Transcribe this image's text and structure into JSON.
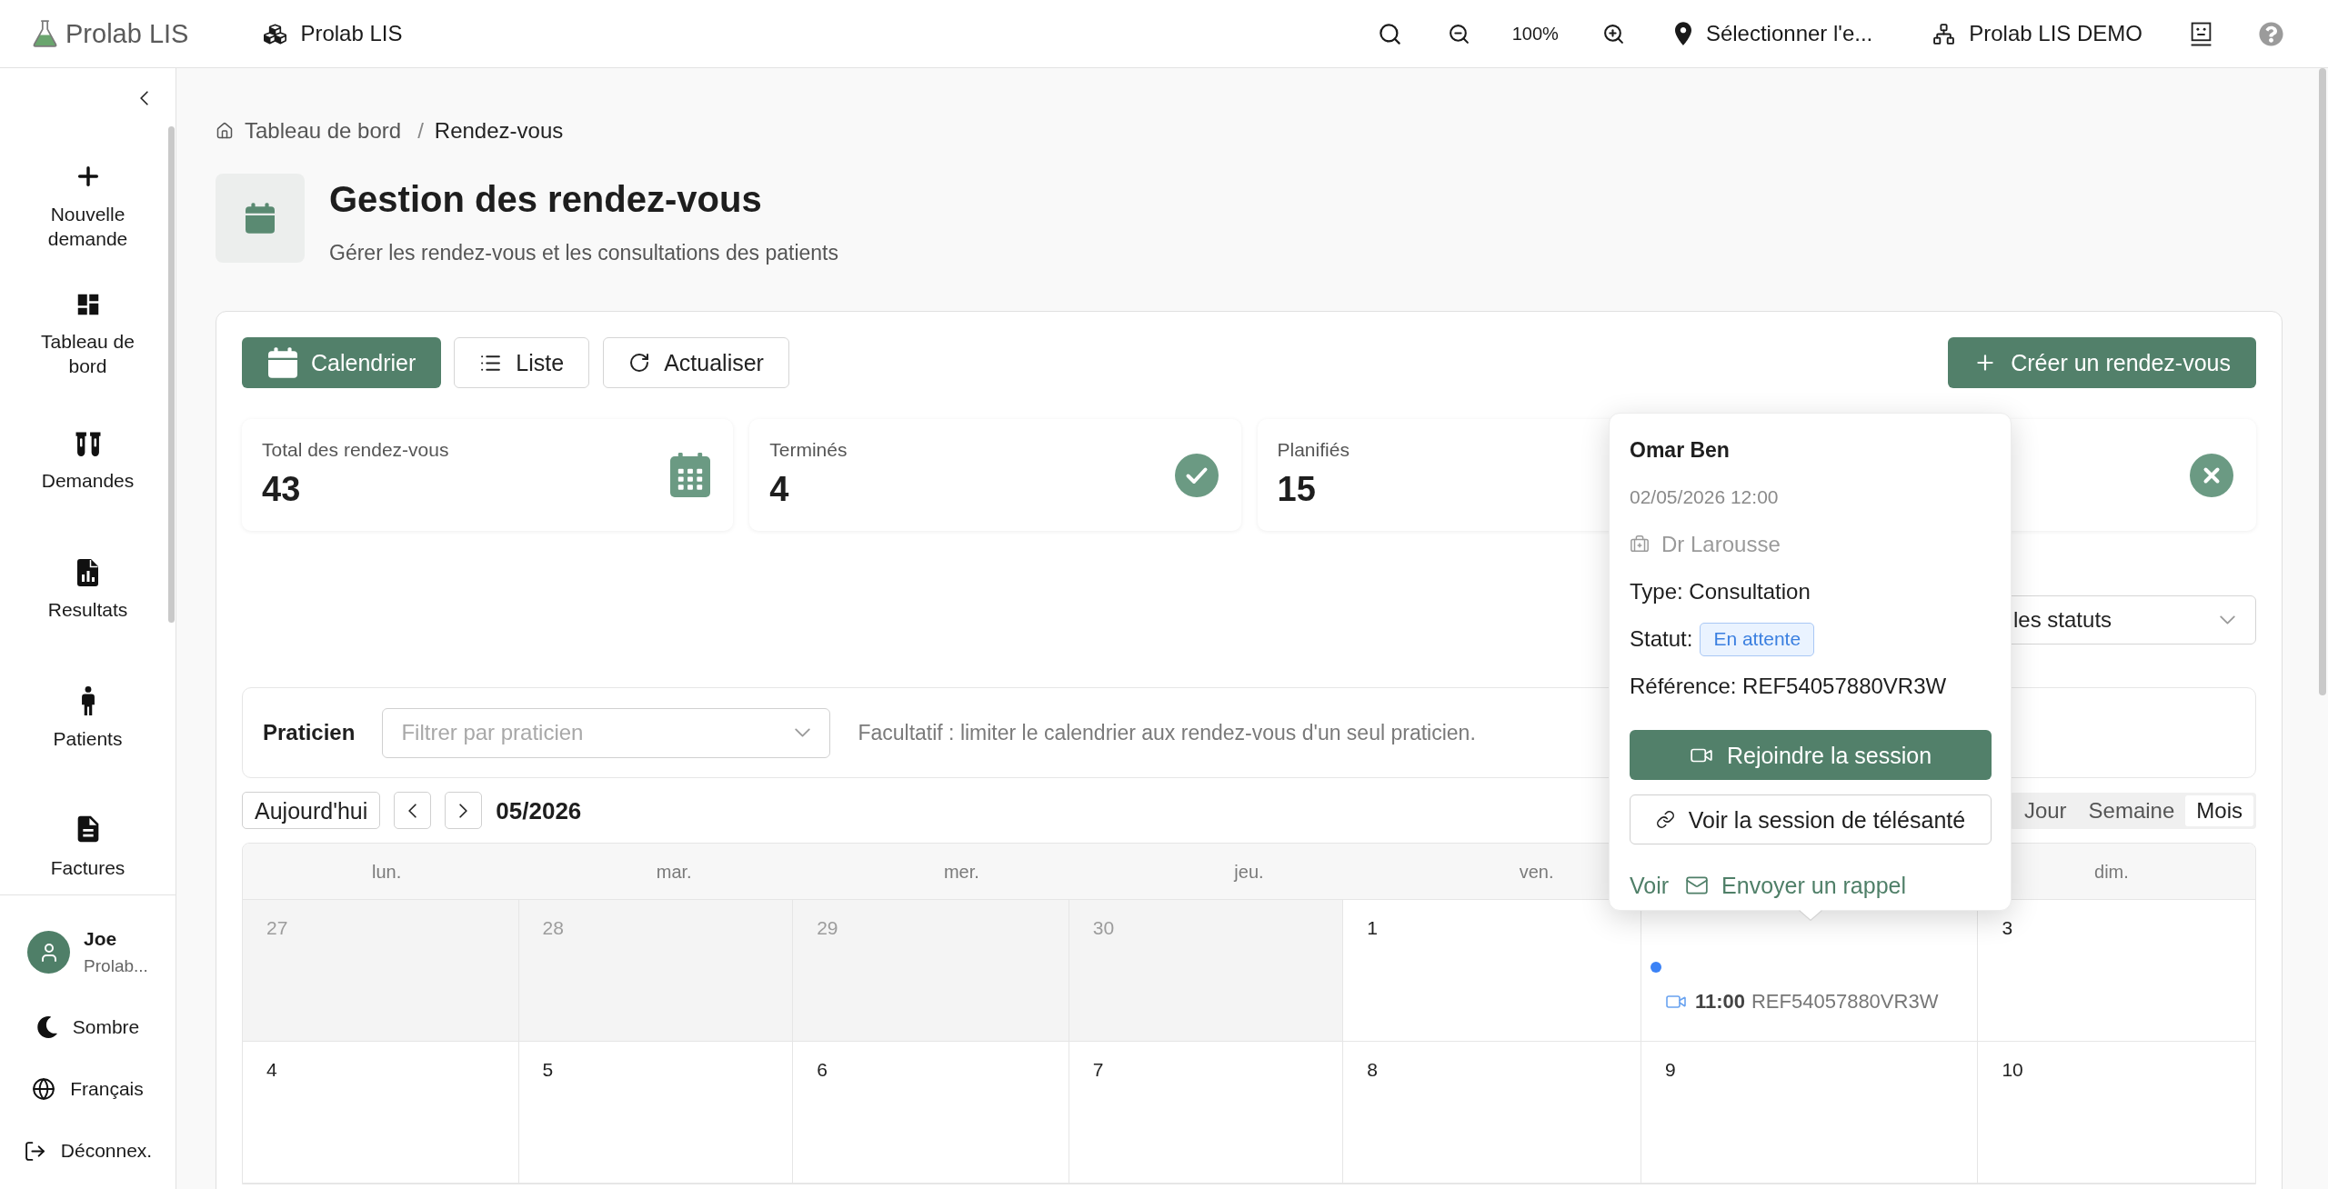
{
  "app": {
    "logo": "Prolab LIS",
    "workspace": "Prolab LIS"
  },
  "topbar": {
    "zoom": "100%",
    "location": "Sélectionner l'e...",
    "organization": "Prolab LIS DEMO"
  },
  "sidebar": {
    "items": [
      {
        "label": "Nouvelle demande",
        "kind": "new"
      },
      {
        "label": "Tableau de bord",
        "kind": "dashboard"
      },
      {
        "label": "Demandes",
        "kind": "requests"
      },
      {
        "label": "Resultats",
        "kind": "results"
      },
      {
        "label": "Patients",
        "kind": "patients"
      },
      {
        "label": "Factures",
        "kind": "invoices"
      }
    ],
    "user": {
      "name": "Joe",
      "organization": "Prolab..."
    },
    "actions": [
      {
        "label": "Sombre",
        "kind": "theme"
      },
      {
        "label": "Français",
        "kind": "language"
      },
      {
        "label": "Déconnex.",
        "kind": "logout"
      }
    ]
  },
  "breadcrumb": {
    "items": [
      {
        "label": "Tableau de bord",
        "kind": "home"
      },
      {
        "label": "Rendez-vous",
        "kind": "current"
      }
    ],
    "separator": "/"
  },
  "page": {
    "title": "Gestion des rendez-vous",
    "subtitle": "Gérer les rendez-vous et les consultations des patients"
  },
  "view_buttons": [
    {
      "label": "Calendrier",
      "kind": "calendar",
      "selected": true
    },
    {
      "label": "Liste",
      "kind": "list",
      "selected": false
    }
  ],
  "refresh_button": "Actualiser",
  "create_button": "Créer un rendez-vous",
  "stats": [
    {
      "label": "Total des rendez-vous",
      "value": "43",
      "kind": "total"
    },
    {
      "label": "Terminés",
      "value": "4",
      "kind": "completed"
    },
    {
      "label": "Planifiés",
      "value": "15",
      "kind": "planned"
    },
    {
      "kind": "cancelled"
    }
  ],
  "status_filter": {
    "value": "les statuts"
  },
  "practitioner_filter": {
    "label": "Praticien",
    "placeholder": "Filtrer par praticien",
    "hint": "Facultatif : limiter le calendrier aux rendez-vous d'un seul praticien."
  },
  "calendar": {
    "today_button": "Aujourd'hui",
    "period": "05/2026",
    "views": [
      {
        "label": "Jour",
        "selected": false
      },
      {
        "label": "Semaine",
        "selected": false
      },
      {
        "label": "Mois",
        "selected": true
      }
    ],
    "weekdays": [
      "lun.",
      "mar.",
      "mer.",
      "jeu.",
      "ven.",
      "dim."
    ],
    "weeks": [
      {
        "days": [
          {
            "day": "27",
            "outside": true
          },
          {
            "day": "28",
            "outside": true
          },
          {
            "day": "29",
            "outside": true
          },
          {
            "day": "30",
            "outside": true
          },
          {
            "day": "1",
            "outside": false
          },
          {
            "outside": false,
            "events": [
              {
                "time": "11:00",
                "reference": "REF54057880VR3W",
                "kind": "video",
                "color": "#3b82f6"
              }
            ]
          },
          {
            "day": "3",
            "outside": false
          }
        ]
      },
      {
        "days": [
          {
            "day": "4",
            "outside": false
          },
          {
            "day": "5",
            "outside": false
          },
          {
            "day": "6",
            "outside": false
          },
          {
            "day": "7",
            "outside": false
          },
          {
            "day": "8",
            "outside": false
          },
          {
            "day": "9",
            "outside": false
          },
          {
            "day": "10",
            "outside": false
          }
        ]
      }
    ]
  },
  "popover": {
    "name": "Omar Ben",
    "datetime": "02/05/2026 12:00",
    "practitioner": "Dr Larousse",
    "type": "Type: Consultation",
    "status_label": "Statut:",
    "status": "En attente",
    "reference": "Référence: REF54057880VR3W",
    "actions": [
      {
        "label": "Rejoindre la session",
        "kind": "join"
      },
      {
        "label": "Voir la session de télésanté",
        "kind": "link"
      }
    ],
    "links": [
      {
        "label": "Voir",
        "kind": "view"
      },
      {
        "label": "Envoyer un rappel",
        "kind": "reminder"
      }
    ]
  }
}
